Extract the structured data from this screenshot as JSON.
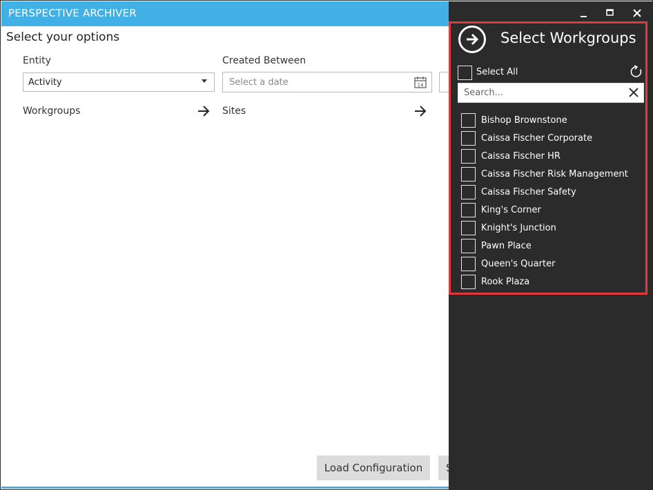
{
  "window": {
    "title": "PERSPECTIVE ARCHIVER"
  },
  "main": {
    "heading": "Select your options",
    "entity": {
      "label": "Entity",
      "value": "Activity"
    },
    "created_between": {
      "label": "Created Between",
      "placeholder": "Select a date"
    },
    "workgroups_label": "Workgroups",
    "sites_label": "Sites",
    "load_button": "Load Configuration",
    "next_button_partial": "S"
  },
  "panel": {
    "title": "Select Workgroups",
    "select_all": "Select All",
    "search_placeholder": "Search...",
    "items": [
      {
        "label": "Bishop Brownstone"
      },
      {
        "label": "Caissa Fischer Corporate"
      },
      {
        "label": "Caissa Fischer HR"
      },
      {
        "label": "Caissa Fischer Risk Management"
      },
      {
        "label": "Caissa Fischer Safety"
      },
      {
        "label": "King's Corner"
      },
      {
        "label": "Knight's Junction"
      },
      {
        "label": "Pawn Place"
      },
      {
        "label": "Queen's Quarter"
      },
      {
        "label": "Rook Plaza"
      }
    ]
  },
  "colors": {
    "accent": "#41b0e4",
    "panel_bg": "#2b2b2b",
    "highlight": "#e03a3a",
    "button_bg": "#dcdcdc"
  }
}
